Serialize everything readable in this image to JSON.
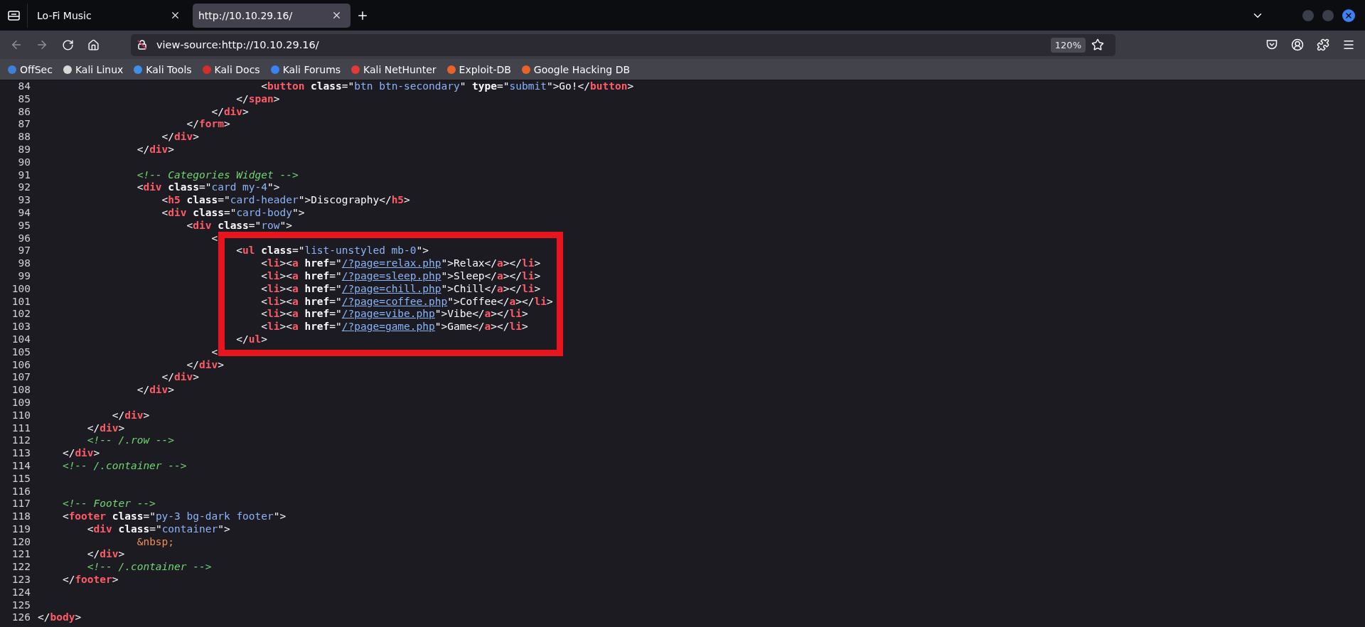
{
  "tabs": [
    {
      "title": "Lo-Fi Music",
      "selected": false
    },
    {
      "title": "http://10.10.29.16/",
      "selected": true
    }
  ],
  "address_bar": {
    "url": "view-source:http://10.10.29.16/",
    "zoom": "120%"
  },
  "bookmarks": [
    {
      "label": "OffSec",
      "color": "#3d7fd9"
    },
    {
      "label": "Kali Linux",
      "color": "#d8d8d8"
    },
    {
      "label": "Kali Tools",
      "color": "#3f8ee8"
    },
    {
      "label": "Kali Docs",
      "color": "#d62d2d"
    },
    {
      "label": "Kali Forums",
      "color": "#3b82f6"
    },
    {
      "label": "Kali NetHunter",
      "color": "#e23a3a"
    },
    {
      "label": "Exploit-DB",
      "color": "#e8622c"
    },
    {
      "label": "Google Hacking DB",
      "color": "#e8622c"
    }
  ],
  "source_lines": [
    {
      "number": "84",
      "tokens": [
        {
          "kind": "p",
          "text": "                                    <"
        },
        {
          "kind": "t",
          "text": "button"
        },
        {
          "kind": "a",
          "text": " class"
        },
        {
          "kind": "p",
          "text": "=\""
        },
        {
          "kind": "v",
          "text": "btn btn-secondary"
        },
        {
          "kind": "p",
          "text": "\""
        },
        {
          "kind": "a",
          "text": " type"
        },
        {
          "kind": "p",
          "text": "=\""
        },
        {
          "kind": "v",
          "text": "submit"
        },
        {
          "kind": "p",
          "text": "\">Go!</"
        },
        {
          "kind": "t",
          "text": "button"
        },
        {
          "kind": "p",
          "text": ">"
        }
      ]
    },
    {
      "number": "85",
      "tokens": [
        {
          "kind": "p",
          "text": "                                </"
        },
        {
          "kind": "t",
          "text": "span"
        },
        {
          "kind": "p",
          "text": ">"
        }
      ]
    },
    {
      "number": "86",
      "tokens": [
        {
          "kind": "p",
          "text": "                            </"
        },
        {
          "kind": "t",
          "text": "div"
        },
        {
          "kind": "p",
          "text": ">"
        }
      ]
    },
    {
      "number": "87",
      "tokens": [
        {
          "kind": "p",
          "text": "                        </"
        },
        {
          "kind": "t",
          "text": "form"
        },
        {
          "kind": "p",
          "text": ">"
        }
      ]
    },
    {
      "number": "88",
      "tokens": [
        {
          "kind": "p",
          "text": "                    </"
        },
        {
          "kind": "t",
          "text": "div"
        },
        {
          "kind": "p",
          "text": ">"
        }
      ]
    },
    {
      "number": "89",
      "tokens": [
        {
          "kind": "p",
          "text": "                </"
        },
        {
          "kind": "t",
          "text": "div"
        },
        {
          "kind": "p",
          "text": ">"
        }
      ]
    },
    {
      "number": "90"
    },
    {
      "number": "91",
      "tokens": [
        {
          "kind": "c",
          "text": "                <!-- Categories Widget -->"
        }
      ]
    },
    {
      "number": "92",
      "tokens": [
        {
          "kind": "p",
          "text": "                <"
        },
        {
          "kind": "t",
          "text": "div"
        },
        {
          "kind": "a",
          "text": " class"
        },
        {
          "kind": "p",
          "text": "=\""
        },
        {
          "kind": "v",
          "text": "card my-4"
        },
        {
          "kind": "p",
          "text": "\">"
        }
      ]
    },
    {
      "number": "93",
      "tokens": [
        {
          "kind": "p",
          "text": "                    <"
        },
        {
          "kind": "t",
          "text": "h5"
        },
        {
          "kind": "a",
          "text": " class"
        },
        {
          "kind": "p",
          "text": "=\""
        },
        {
          "kind": "v",
          "text": "card-header"
        },
        {
          "kind": "p",
          "text": "\">Discography</"
        },
        {
          "kind": "t",
          "text": "h5"
        },
        {
          "kind": "p",
          "text": ">"
        }
      ]
    },
    {
      "number": "94",
      "tokens": [
        {
          "kind": "p",
          "text": "                    <"
        },
        {
          "kind": "t",
          "text": "div"
        },
        {
          "kind": "a",
          "text": " class"
        },
        {
          "kind": "p",
          "text": "=\""
        },
        {
          "kind": "v",
          "text": "card-body"
        },
        {
          "kind": "p",
          "text": "\">"
        }
      ]
    },
    {
      "number": "95",
      "tokens": [
        {
          "kind": "p",
          "text": "                        <"
        },
        {
          "kind": "t",
          "text": "div"
        },
        {
          "kind": "a",
          "text": " class"
        },
        {
          "kind": "p",
          "text": "=\""
        },
        {
          "kind": "v",
          "text": "row"
        },
        {
          "kind": "p",
          "text": "\">"
        }
      ]
    },
    {
      "number": "96",
      "tokens": [
        {
          "kind": "p",
          "text": "                            <"
        }
      ]
    },
    {
      "number": "97",
      "tokens": [
        {
          "kind": "p",
          "text": "                                <"
        },
        {
          "kind": "t",
          "text": "ul"
        },
        {
          "kind": "a",
          "text": " class"
        },
        {
          "kind": "p",
          "text": "=\""
        },
        {
          "kind": "v",
          "text": "list-unstyled mb-0"
        },
        {
          "kind": "p",
          "text": "\">"
        }
      ]
    },
    {
      "number": "98",
      "tokens": [
        {
          "kind": "p",
          "text": "                                    <"
        },
        {
          "kind": "t",
          "text": "li"
        },
        {
          "kind": "p",
          "text": "><"
        },
        {
          "kind": "t",
          "text": "a"
        },
        {
          "kind": "a",
          "text": " href"
        },
        {
          "kind": "p",
          "text": "=\""
        },
        {
          "kind": "l",
          "text": "/?page=relax.php"
        },
        {
          "kind": "p",
          "text": "\">Relax</"
        },
        {
          "kind": "t",
          "text": "a"
        },
        {
          "kind": "p",
          "text": "></"
        },
        {
          "kind": "t",
          "text": "li"
        },
        {
          "kind": "p",
          "text": ">"
        }
      ]
    },
    {
      "number": "99",
      "tokens": [
        {
          "kind": "p",
          "text": "                                    <"
        },
        {
          "kind": "t",
          "text": "li"
        },
        {
          "kind": "p",
          "text": "><"
        },
        {
          "kind": "t",
          "text": "a"
        },
        {
          "kind": "a",
          "text": " href"
        },
        {
          "kind": "p",
          "text": "=\""
        },
        {
          "kind": "l",
          "text": "/?page=sleep.php"
        },
        {
          "kind": "p",
          "text": "\">Sleep</"
        },
        {
          "kind": "t",
          "text": "a"
        },
        {
          "kind": "p",
          "text": "></"
        },
        {
          "kind": "t",
          "text": "li"
        },
        {
          "kind": "p",
          "text": ">"
        }
      ]
    },
    {
      "number": "100",
      "tokens": [
        {
          "kind": "p",
          "text": "                                    <"
        },
        {
          "kind": "t",
          "text": "li"
        },
        {
          "kind": "p",
          "text": "><"
        },
        {
          "kind": "t",
          "text": "a"
        },
        {
          "kind": "a",
          "text": " href"
        },
        {
          "kind": "p",
          "text": "=\""
        },
        {
          "kind": "l",
          "text": "/?page=chill.php"
        },
        {
          "kind": "p",
          "text": "\">Chill</"
        },
        {
          "kind": "t",
          "text": "a"
        },
        {
          "kind": "p",
          "text": "></"
        },
        {
          "kind": "t",
          "text": "li"
        },
        {
          "kind": "p",
          "text": ">"
        }
      ]
    },
    {
      "number": "101",
      "tokens": [
        {
          "kind": "p",
          "text": "                                    <"
        },
        {
          "kind": "t",
          "text": "li"
        },
        {
          "kind": "p",
          "text": "><"
        },
        {
          "kind": "t",
          "text": "a"
        },
        {
          "kind": "a",
          "text": " href"
        },
        {
          "kind": "p",
          "text": "=\""
        },
        {
          "kind": "l",
          "text": "/?page=coffee.php"
        },
        {
          "kind": "p",
          "text": "\">Coffee</"
        },
        {
          "kind": "t",
          "text": "a"
        },
        {
          "kind": "p",
          "text": "></"
        },
        {
          "kind": "t",
          "text": "li"
        },
        {
          "kind": "p",
          "text": ">"
        }
      ]
    },
    {
      "number": "102",
      "tokens": [
        {
          "kind": "p",
          "text": "                                    <"
        },
        {
          "kind": "t",
          "text": "li"
        },
        {
          "kind": "p",
          "text": "><"
        },
        {
          "kind": "t",
          "text": "a"
        },
        {
          "kind": "a",
          "text": " href"
        },
        {
          "kind": "p",
          "text": "=\""
        },
        {
          "kind": "l",
          "text": "/?page=vibe.php"
        },
        {
          "kind": "p",
          "text": "\">Vibe</"
        },
        {
          "kind": "t",
          "text": "a"
        },
        {
          "kind": "p",
          "text": "></"
        },
        {
          "kind": "t",
          "text": "li"
        },
        {
          "kind": "p",
          "text": ">"
        }
      ]
    },
    {
      "number": "103",
      "tokens": [
        {
          "kind": "p",
          "text": "                                    <"
        },
        {
          "kind": "t",
          "text": "li"
        },
        {
          "kind": "p",
          "text": "><"
        },
        {
          "kind": "t",
          "text": "a"
        },
        {
          "kind": "a",
          "text": " href"
        },
        {
          "kind": "p",
          "text": "=\""
        },
        {
          "kind": "l",
          "text": "/?page=game.php"
        },
        {
          "kind": "p",
          "text": "\">Game</"
        },
        {
          "kind": "t",
          "text": "a"
        },
        {
          "kind": "p",
          "text": "></"
        },
        {
          "kind": "t",
          "text": "li"
        },
        {
          "kind": "p",
          "text": ">"
        }
      ]
    },
    {
      "number": "104",
      "tokens": [
        {
          "kind": "p",
          "text": "                                </"
        },
        {
          "kind": "t",
          "text": "ul"
        },
        {
          "kind": "p",
          "text": ">"
        }
      ]
    },
    {
      "number": "105",
      "tokens": [
        {
          "kind": "p",
          "text": "                            <"
        }
      ]
    },
    {
      "number": "106",
      "tokens": [
        {
          "kind": "p",
          "text": "                        </"
        },
        {
          "kind": "t",
          "text": "div"
        },
        {
          "kind": "p",
          "text": ">"
        }
      ]
    },
    {
      "number": "107",
      "tokens": [
        {
          "kind": "p",
          "text": "                    </"
        },
        {
          "kind": "t",
          "text": "div"
        },
        {
          "kind": "p",
          "text": ">"
        }
      ]
    },
    {
      "number": "108",
      "tokens": [
        {
          "kind": "p",
          "text": "                </"
        },
        {
          "kind": "t",
          "text": "div"
        },
        {
          "kind": "p",
          "text": ">"
        }
      ]
    },
    {
      "number": "109"
    },
    {
      "number": "110",
      "tokens": [
        {
          "kind": "p",
          "text": "            </"
        },
        {
          "kind": "t",
          "text": "div"
        },
        {
          "kind": "p",
          "text": ">"
        }
      ]
    },
    {
      "number": "111",
      "tokens": [
        {
          "kind": "p",
          "text": "        </"
        },
        {
          "kind": "t",
          "text": "div"
        },
        {
          "kind": "p",
          "text": ">"
        }
      ]
    },
    {
      "number": "112",
      "tokens": [
        {
          "kind": "c",
          "text": "        <!-- /.row -->"
        }
      ]
    },
    {
      "number": "113",
      "tokens": [
        {
          "kind": "p",
          "text": "    </"
        },
        {
          "kind": "t",
          "text": "div"
        },
        {
          "kind": "p",
          "text": ">"
        }
      ]
    },
    {
      "number": "114",
      "tokens": [
        {
          "kind": "c",
          "text": "    <!-- /.container -->"
        }
      ]
    },
    {
      "number": "115"
    },
    {
      "number": "116"
    },
    {
      "number": "117",
      "tokens": [
        {
          "kind": "c",
          "text": "    <!-- Footer -->"
        }
      ]
    },
    {
      "number": "118",
      "tokens": [
        {
          "kind": "p",
          "text": "    <"
        },
        {
          "kind": "t",
          "text": "footer"
        },
        {
          "kind": "a",
          "text": " class"
        },
        {
          "kind": "p",
          "text": "=\""
        },
        {
          "kind": "v",
          "text": "py-3 bg-dark footer"
        },
        {
          "kind": "p",
          "text": "\">"
        }
      ]
    },
    {
      "number": "119",
      "tokens": [
        {
          "kind": "p",
          "text": "        <"
        },
        {
          "kind": "t",
          "text": "div"
        },
        {
          "kind": "a",
          "text": " class"
        },
        {
          "kind": "p",
          "text": "=\""
        },
        {
          "kind": "v",
          "text": "container"
        },
        {
          "kind": "p",
          "text": "\">"
        }
      ]
    },
    {
      "number": "120",
      "tokens": [
        {
          "kind": "e",
          "text": "                &nbsp;"
        }
      ]
    },
    {
      "number": "121",
      "tokens": [
        {
          "kind": "p",
          "text": "        </"
        },
        {
          "kind": "t",
          "text": "div"
        },
        {
          "kind": "p",
          "text": ">"
        }
      ]
    },
    {
      "number": "122",
      "tokens": [
        {
          "kind": "c",
          "text": "        <!-- /.container -->"
        }
      ]
    },
    {
      "number": "123",
      "tokens": [
        {
          "kind": "p",
          "text": "    </"
        },
        {
          "kind": "t",
          "text": "footer"
        },
        {
          "kind": "p",
          "text": ">"
        }
      ]
    },
    {
      "number": "124"
    },
    {
      "number": "125"
    },
    {
      "number": "126",
      "tokens": [
        {
          "kind": "p",
          "text": "</"
        },
        {
          "kind": "t",
          "text": "body"
        },
        {
          "kind": "p",
          "text": ">"
        }
      ]
    }
  ]
}
